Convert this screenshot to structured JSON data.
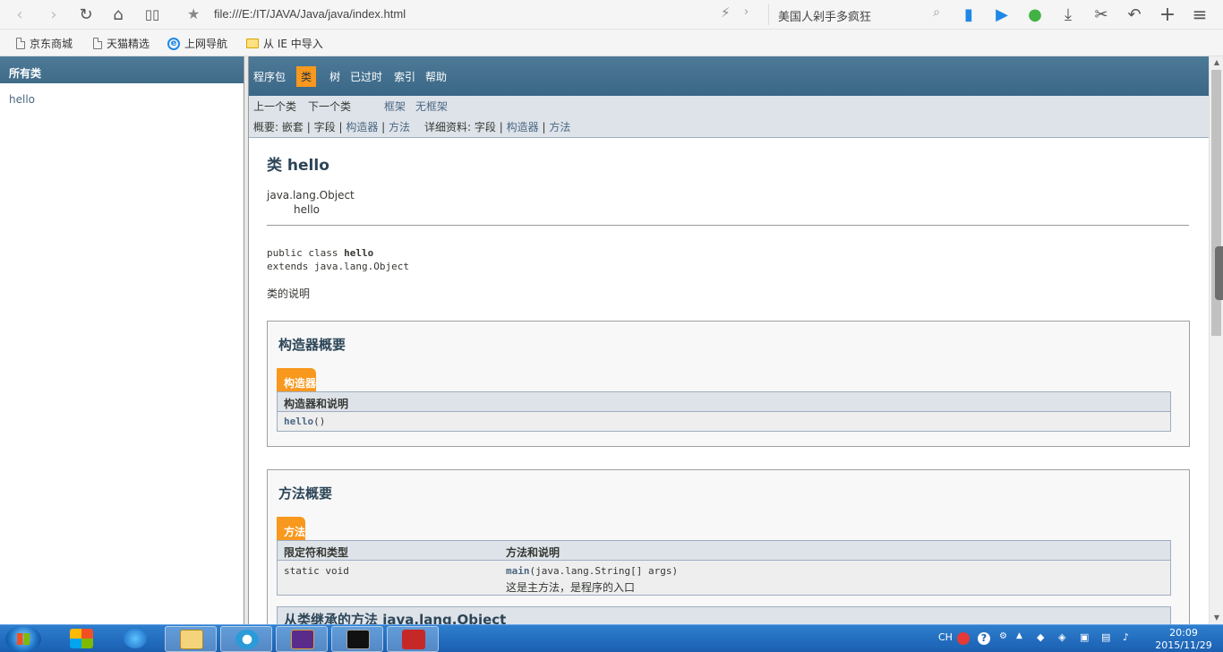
{
  "browser": {
    "url": "file:///E:/IT/JAVA/Java/java/index.html",
    "search_query": "美国人剁手多疯狂",
    "bookmarks": [
      {
        "label": "京东商城",
        "icon": "page-icon"
      },
      {
        "label": "天猫精选",
        "icon": "page-icon"
      },
      {
        "label": "上网导航",
        "icon": "ie-icon"
      },
      {
        "label": "从 IE 中导入",
        "icon": "folder-icon"
      }
    ]
  },
  "left_frame": {
    "header": "所有类",
    "classes": [
      "hello"
    ]
  },
  "topnav": {
    "items": [
      "程序包",
      "类",
      "树",
      "已过时",
      "索引",
      "帮助"
    ],
    "active": "类"
  },
  "subnav": {
    "prev_class": "上一个类",
    "next_class": "下一个类",
    "frames": "框架",
    "no_frames": "无框架",
    "summary_label": "概要:",
    "summary_nested": "嵌套",
    "summary_field": "字段",
    "summary_constructor": "构造器",
    "summary_method": "方法",
    "detail_label": "详细资料:",
    "detail_field": "字段",
    "detail_constructor": "构造器",
    "detail_method": "方法",
    "separator": "|"
  },
  "class_doc": {
    "title": "类 hello",
    "inheritance_parent": "java.lang.Object",
    "inheritance_child": "hello",
    "decl_prefix": "public class ",
    "decl_name": "hello",
    "decl_extends": "extends java.lang.Object",
    "description": "类的说明"
  },
  "constructor_summary": {
    "heading": "构造器概要",
    "tab": "构造器",
    "column": "构造器和说明",
    "rows": [
      {
        "name": "hello",
        "params": "()"
      }
    ]
  },
  "method_summary": {
    "heading": "方法概要",
    "tab": "方法",
    "columns": [
      "限定符和类型",
      "方法和说明"
    ],
    "rows": [
      {
        "modifier": "static void",
        "name": "main",
        "params": "(java.lang.String[]  args)",
        "description": "这是主方法，是程序的入口"
      }
    ],
    "inherited_heading": "从类继承的方法 java.lang.Object"
  },
  "taskbar": {
    "ime": "CH",
    "time": "20:09",
    "date": "2015/11/29"
  }
}
